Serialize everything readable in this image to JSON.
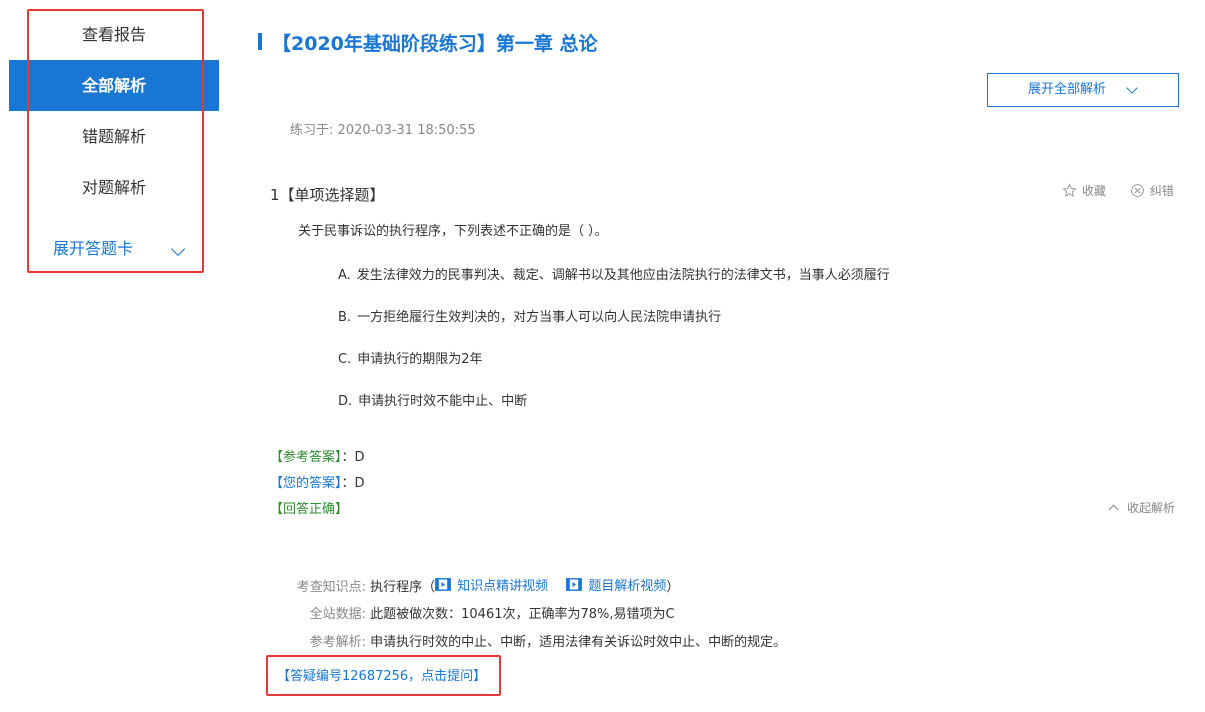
{
  "sidebar": {
    "items": [
      {
        "label": "查看报告"
      },
      {
        "label": "全部解析"
      },
      {
        "label": "错题解析"
      },
      {
        "label": "对题解析"
      }
    ],
    "expand_label": "展开答题卡"
  },
  "main": {
    "title": "【2020年基础阶段练习】第一章 总论",
    "expand_all_label": "展开全部解析",
    "practice_time_label": "练习于:",
    "practice_time_value": "2020-03-31 18:50:55"
  },
  "question": {
    "number": "1",
    "type": "【单项选择题】",
    "favorite_label": "收藏",
    "report_error_label": "纠错",
    "stem": "关于民事诉讼的执行程序，下列表述不正确的是（   ）。",
    "options": [
      {
        "letter": "A.",
        "text": "发生法律效力的民事判决、裁定、调解书以及其他应由法院执行的法律文书，当事人必须履行"
      },
      {
        "letter": "B.",
        "text": "一方拒绝履行生效判决的，对方当事人可以向人民法院申请执行"
      },
      {
        "letter": "C.",
        "text": "申请执行的期限为2年"
      },
      {
        "letter": "D.",
        "text": "申请执行时效不能中止、中断"
      }
    ],
    "reference_answer_label": "【参考答案】",
    "reference_answer_value": "D",
    "your_answer_label": "【您的答案】",
    "your_answer_value": "D",
    "result_label": "【回答正确】",
    "collapse_label": "收起解析",
    "analysis": {
      "knowledge_label": "考查知识点:",
      "knowledge_value": "执行程序（",
      "video1_label": "知识点精讲视频",
      "video2_label": "题目解析视频",
      "knowledge_close": "）",
      "stats_label": "全站数据:",
      "stats_value": "此题被做次数：10461次，正确率为78%,易错项为C",
      "explain_label": "参考解析:",
      "explain_value": "申请执行时效的中止、中断，适用法律有关诉讼时效中止、中断的规定。"
    },
    "ask_link": "【答疑编号12687256，点击提问】"
  },
  "colors": {
    "accent": "#1976d2",
    "correct": "#2e8b2e",
    "highlight_box": "#e53935"
  }
}
